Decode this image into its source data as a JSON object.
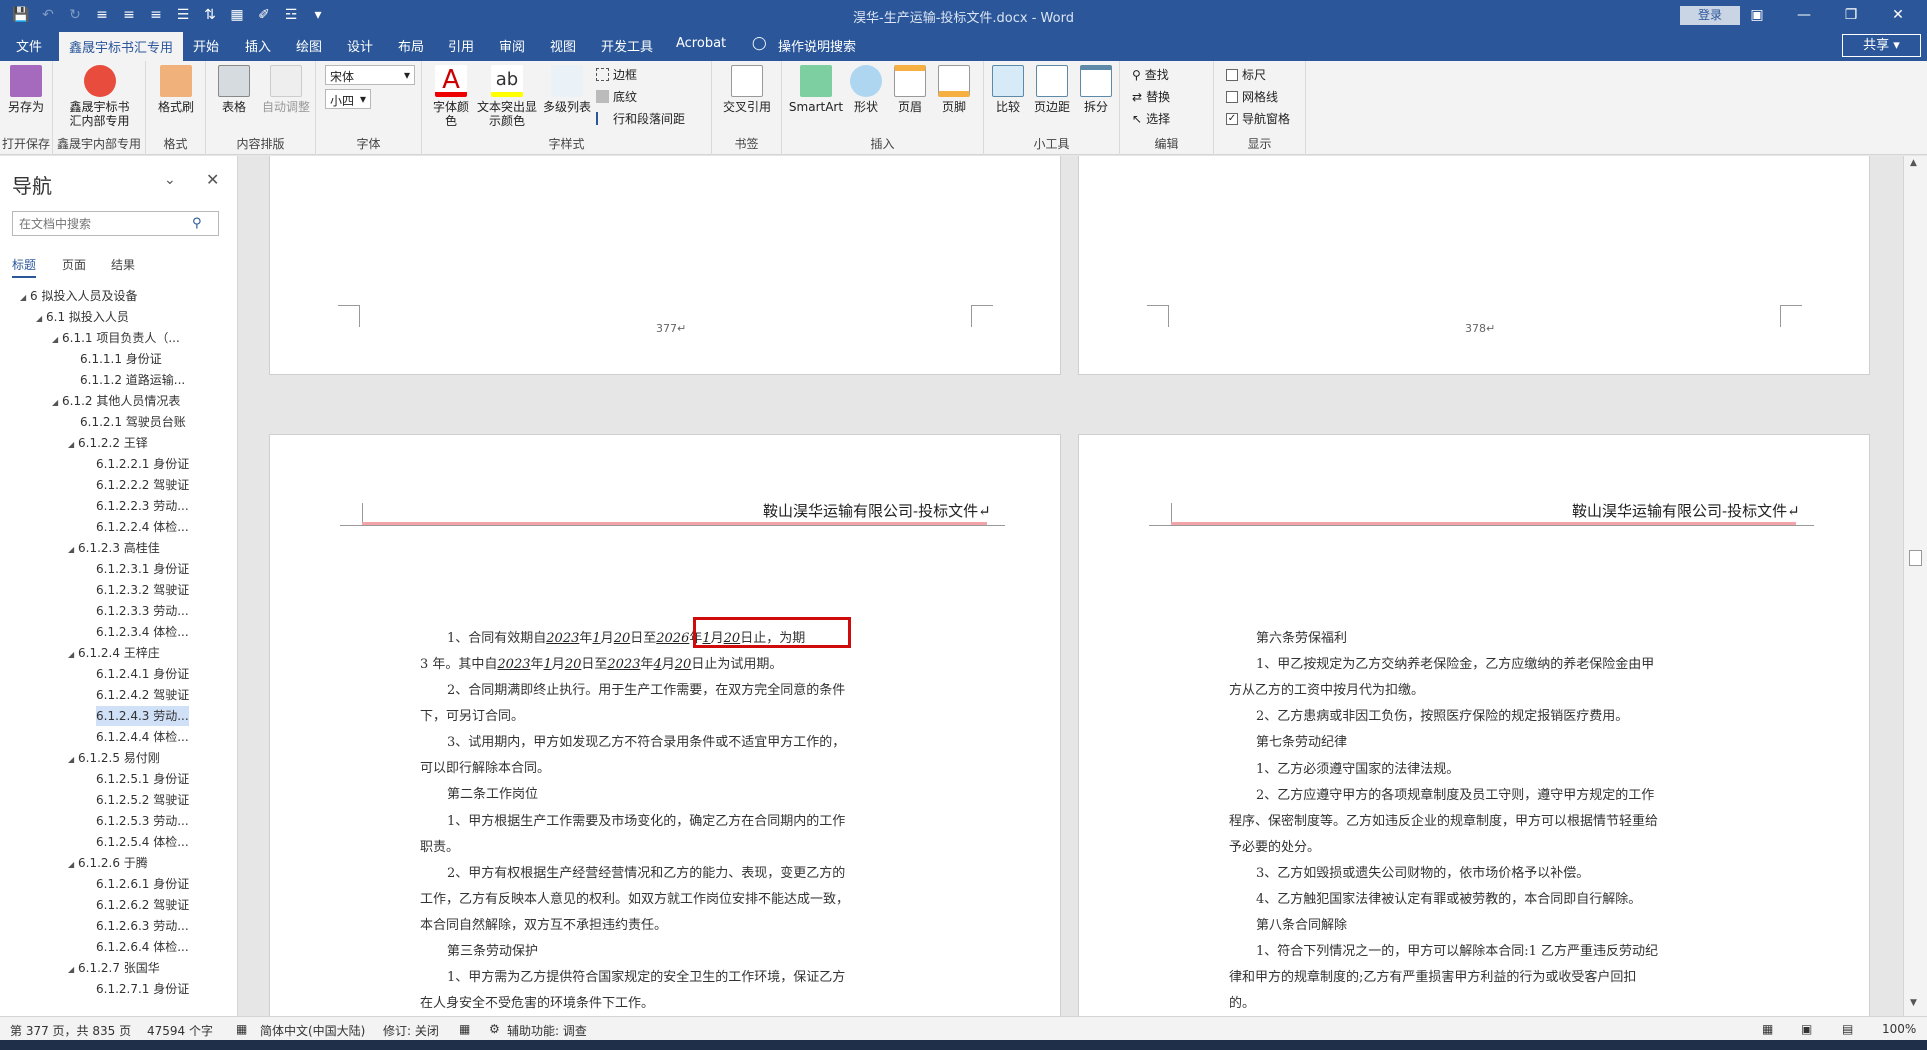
{
  "window": {
    "title": "淏华-生产运输-投标文件.docx - Word",
    "login": "登录",
    "share": "共享"
  },
  "qat_icons": [
    "save-icon",
    "undo-icon",
    "redo-icon",
    "align-left-icon",
    "align-center-icon",
    "align-right-icon",
    "justify-icon",
    "line-spacing-icon",
    "save-as-icon",
    "format-painter-icon",
    "list-icon",
    "customize-icon"
  ],
  "tabs": [
    "文件",
    "鑫晟宇标书汇专用",
    "开始",
    "插入",
    "绘图",
    "设计",
    "布局",
    "引用",
    "审阅",
    "视图",
    "开发工具",
    "Acrobat",
    "操作说明搜索"
  ],
  "ribbon": {
    "groups": {
      "save": {
        "label": "打开保存",
        "btn": "另存为"
      },
      "xsy": {
        "label": "鑫晟宇内部专用",
        "btn1": "鑫晟宇标书",
        "btn2": "汇内部专用"
      },
      "fmt": {
        "label": "格式",
        "btn": "格式刷"
      },
      "layout": {
        "label": "内容排版",
        "btn1": "表格",
        "btn2": "自动调整"
      },
      "font": {
        "label": "字体",
        "name": "宋体",
        "size": "小四"
      },
      "style": {
        "label": "字样式",
        "btn1a": "字体颜",
        "btn1b": "色",
        "btn2a": "文本突出显",
        "btn2b": "示颜色",
        "btn3": "多级列表",
        "s1": "边框",
        "s2": "底纹",
        "s3": "行和段落间距"
      },
      "bookmark": {
        "label": "书签",
        "btn": "交叉引用"
      },
      "insert": {
        "label": "插入",
        "btn1": "SmartArt",
        "btn2": "形状",
        "btn3": "页眉",
        "btn4": "页脚"
      },
      "tools": {
        "label": "小工具",
        "btn1": "比较",
        "btn2": "页边距",
        "btn3": "拆分"
      },
      "edit": {
        "label": "编辑",
        "s1": "查找",
        "s2": "替换",
        "s3": "选择"
      },
      "show": {
        "label": "显示",
        "c1": "标尺",
        "c2": "网格线",
        "c3": "导航窗格"
      }
    }
  },
  "nav": {
    "title": "导航",
    "search_placeholder": "在文档中搜索",
    "tabs": [
      "标题",
      "页面",
      "结果"
    ],
    "tree": [
      {
        "t": "6 拟投入人员及设备",
        "lv": 1,
        "arrow": true
      },
      {
        "t": "6.1 拟投入人员",
        "lv": 2,
        "arrow": true
      },
      {
        "t": "6.1.1 项目负责人（...",
        "lv": 3,
        "arrow": true
      },
      {
        "t": "6.1.1.1 身份证",
        "lv": 4,
        "arrow": false
      },
      {
        "t": "6.1.1.2 道路运输...",
        "lv": 4,
        "arrow": false
      },
      {
        "t": "6.1.2 其他人员情况表",
        "lv": 3,
        "arrow": true
      },
      {
        "t": "6.1.2.1 驾驶员台账",
        "lv": 4,
        "arrow": false
      },
      {
        "t": "6.1.2.2 王铎",
        "lv": 4,
        "arrow": true
      },
      {
        "t": "6.1.2.2.1 身份证",
        "lv": 5,
        "arrow": false
      },
      {
        "t": "6.1.2.2.2 驾驶证",
        "lv": 5,
        "arrow": false
      },
      {
        "t": "6.1.2.2.3 劳动...",
        "lv": 5,
        "arrow": false
      },
      {
        "t": "6.1.2.2.4 体检...",
        "lv": 5,
        "arrow": false
      },
      {
        "t": "6.1.2.3 高桂佳",
        "lv": 4,
        "arrow": true
      },
      {
        "t": "6.1.2.3.1 身份证",
        "lv": 5,
        "arrow": false
      },
      {
        "t": "6.1.2.3.2 驾驶证",
        "lv": 5,
        "arrow": false
      },
      {
        "t": "6.1.2.3.3 劳动...",
        "lv": 5,
        "arrow": false
      },
      {
        "t": "6.1.2.3.4 体检...",
        "lv": 5,
        "arrow": false
      },
      {
        "t": "6.1.2.4 王梓庄",
        "lv": 4,
        "arrow": true
      },
      {
        "t": "6.1.2.4.1 身份证",
        "lv": 5,
        "arrow": false
      },
      {
        "t": "6.1.2.4.2 驾驶证",
        "lv": 5,
        "arrow": false
      },
      {
        "t": "6.1.2.4.3 劳动...",
        "lv": 5,
        "arrow": false,
        "sel": true
      },
      {
        "t": "6.1.2.4.4 体检...",
        "lv": 5,
        "arrow": false
      },
      {
        "t": "6.1.2.5 易付刚",
        "lv": 4,
        "arrow": true
      },
      {
        "t": "6.1.2.5.1 身份证",
        "lv": 5,
        "arrow": false
      },
      {
        "t": "6.1.2.5.2 驾驶证",
        "lv": 5,
        "arrow": false
      },
      {
        "t": "6.1.2.5.3 劳动...",
        "lv": 5,
        "arrow": false
      },
      {
        "t": "6.1.2.5.4 体检...",
        "lv": 5,
        "arrow": false
      },
      {
        "t": "6.1.2.6 于腾",
        "lv": 4,
        "arrow": true
      },
      {
        "t": "6.1.2.6.1 身份证",
        "lv": 5,
        "arrow": false
      },
      {
        "t": "6.1.2.6.2 驾驶证",
        "lv": 5,
        "arrow": false
      },
      {
        "t": "6.1.2.6.3 劳动...",
        "lv": 5,
        "arrow": false
      },
      {
        "t": "6.1.2.6.4 体检...",
        "lv": 5,
        "arrow": false
      },
      {
        "t": "6.1.2.7 张国华",
        "lv": 4,
        "arrow": true
      },
      {
        "t": "6.1.2.7.1 身份证",
        "lv": 5,
        "arrow": false
      }
    ]
  },
  "pages": {
    "p377": "377↵",
    "p378": "378↵",
    "header": "鞍山淏华运输有限公司-投标文件↵"
  },
  "left_doc": {
    "l1": {
      "a": "1、合同有效期自",
      "y1": "2023",
      "b": "年",
      "m1": "1",
      "c": "月",
      "d1": "20",
      "e": "日至",
      "y2": "2026",
      "f": "年",
      "m2": "1",
      "g": "月",
      "d2": "20",
      "h": "日止，为期"
    },
    "l2": {
      "a": "3 年。其中自",
      "y1": "2023",
      "b": "年",
      "m1": "1",
      "c": "月",
      "d1": "20",
      "e": "日至",
      "y2": "2023",
      "f": "年",
      "m2": "4",
      "g": "月",
      "d2": "20",
      "h": "日止为试用期。"
    },
    "lines": [
      "2、合同期满即终止执行。用于生产工作需要，在双方完全同意的条件",
      "下，可另订合同。",
      "3、试用期内，甲方如发现乙方不符合录用条件或不适宜甲方工作的，",
      "可以即行解除本合同。",
      "第二条工作岗位",
      "1、甲方根据生产工作需要及市场变化的，确定乙方在合同期内的工作",
      "职责。",
      "2、甲方有权根据生产经营经营情况和乙方的能力、表现，变更乙方的",
      "工作，乙方有反映本人意见的权利。如双方就工作岗位安排不能达成一致，",
      "本合同自然解除，双方互不承担违约责任。",
      "第三条劳动保护",
      "1、甲方需为乙方提供符合国家规定的安全卫生的工作环境，保证乙方",
      "在人身安全不受危害的环境条件下工作。"
    ]
  },
  "right_doc": {
    "lines": [
      "第六条劳保福利",
      "1、甲乙按规定为乙方交纳养老保险金，乙方应缴纳的养老保险金由甲",
      "方从乙方的工资中按月代为扣缴。",
      "2、乙方患病或非因工负伤，按照医疗保险的规定报销医疗费用。",
      "第七条劳动纪律",
      "1、乙方必须遵守国家的法律法规。",
      "2、乙方应遵守甲方的各项规章制度及员工守则，遵守甲方规定的工作",
      "程序、保密制度等。乙方如违反企业的规章制度，甲方可以根据情节轻重给",
      "予必要的处分。",
      "3、乙方如毁损或遗失公司财物的，依市场价格予以补偿。",
      "4、乙方触犯国家法律被认定有罪或被劳教的，本合同即自行解除。",
      "第八条合同解除",
      "1、符合下列情况之一的，甲方可以解除本合同:1 乙方严重违反劳动纪",
      "律和甲方的规章制度的;乙方有严重损害甲方利益的行为或收受客户回扣",
      "的。"
    ]
  },
  "status": {
    "page": "第 377 页，共 835 页",
    "words": "47594 个字",
    "lang": "简体中文(中国大陆)",
    "track": "修订: 关闭",
    "access": "辅助功能: 调查",
    "zoom": "100%"
  },
  "colors": {
    "brand": "#2b579a",
    "highlight": "#d00b0b",
    "header_rule": "#f3a4a8"
  }
}
